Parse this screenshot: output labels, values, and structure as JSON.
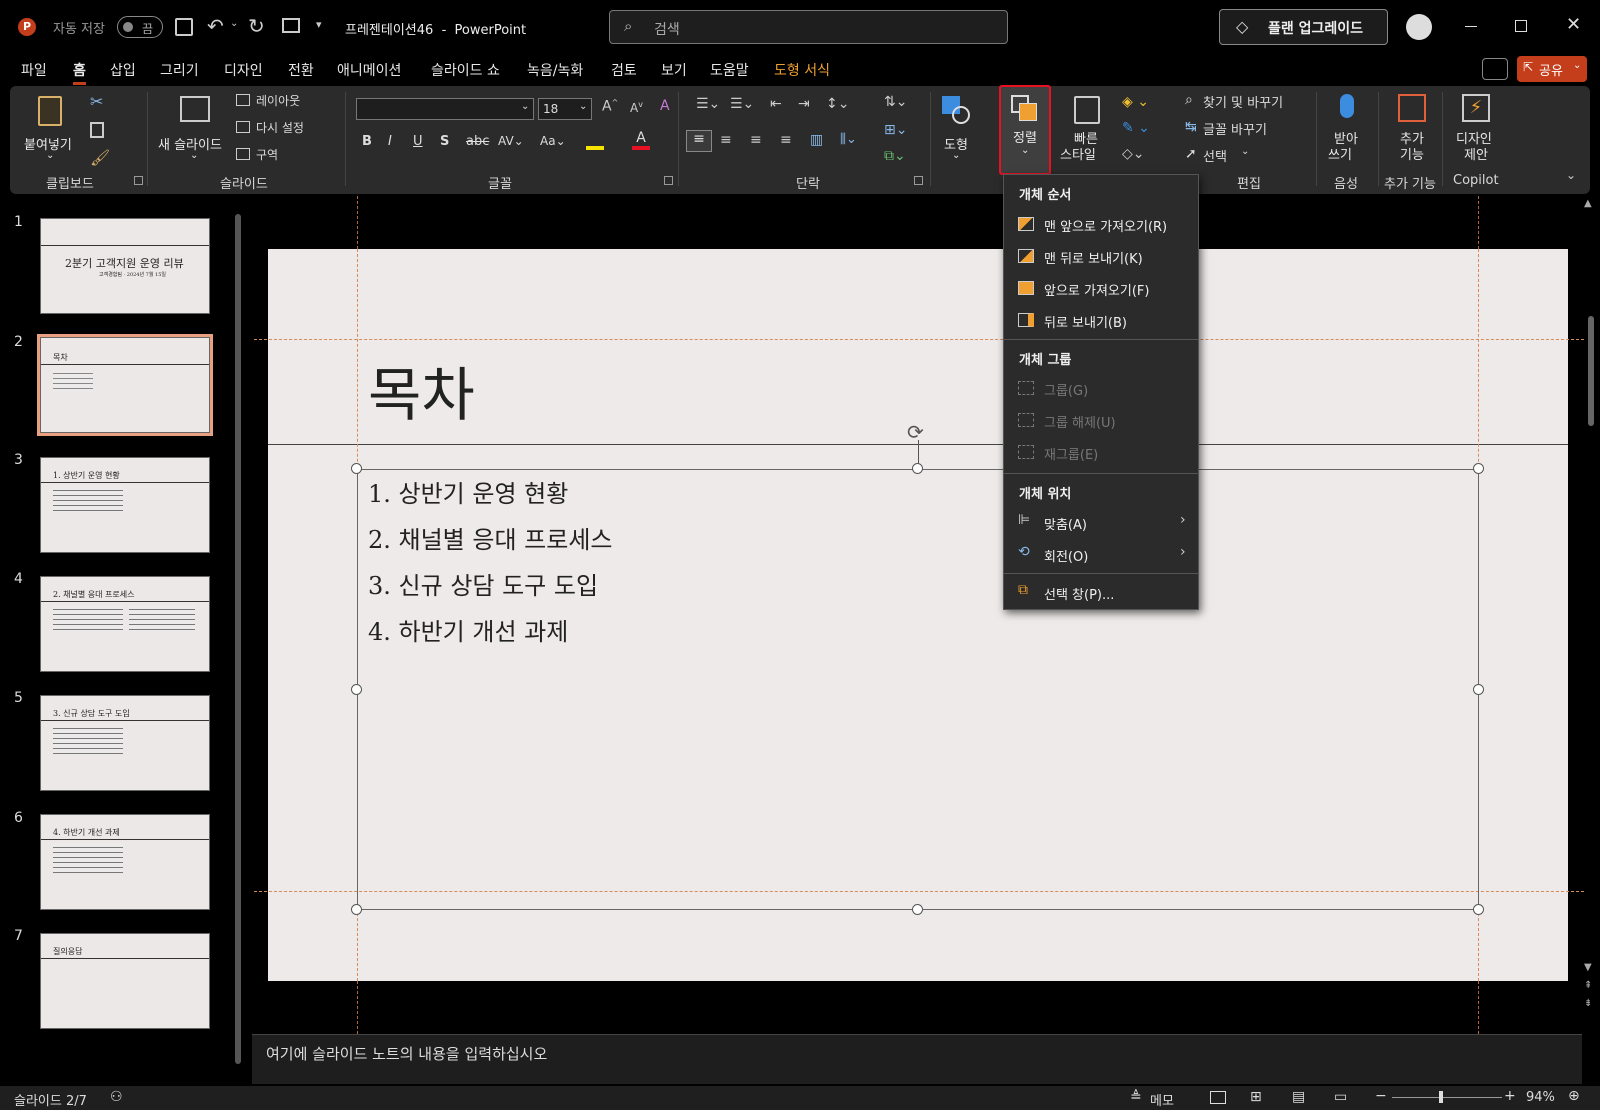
{
  "title_bar": {
    "autosave_label": "자동 저장",
    "autosave_state": "끔",
    "doc_title": "프레젠테이션46  -  PowerPoint",
    "search_placeholder": "검색",
    "upgrade_label": "플랜 업그레이드"
  },
  "tabs": [
    "파일",
    "홈",
    "삽입",
    "그리기",
    "디자인",
    "전환",
    "애니메이션",
    "슬라이드 쇼",
    "녹음/녹화",
    "검토",
    "보기",
    "도움말",
    "도형 서식"
  ],
  "share_label": "공유",
  "ribbon": {
    "clipboard": {
      "paste": "붙여넣기",
      "group": "클립보드"
    },
    "slides": {
      "new_slide": "새 슬라이드",
      "layout": "레이아웃",
      "reset": "다시 설정",
      "section": "구역",
      "group": "슬라이드"
    },
    "font": {
      "font_name": "",
      "font_size": "18",
      "group": "글꼴"
    },
    "paragraph": {
      "group": "단락"
    },
    "drawing": {
      "shapes": "도형",
      "arrange": "정렬",
      "quick_styles_1": "빠른",
      "quick_styles_2": "스타일"
    },
    "editing": {
      "find": "찾기 및 바꾸기",
      "replace": "글꼴 바꾸기",
      "select": "선택",
      "group": "편집"
    },
    "voice": {
      "dictate_1": "받아",
      "dictate_2": "쓰기",
      "group": "음성"
    },
    "addins": {
      "label_1": "추가",
      "label_2": "기능",
      "group": "추가 기능"
    },
    "designer": {
      "label_1": "디자인",
      "label_2": "제안",
      "group": "Copilot"
    }
  },
  "thumbnails": [
    {
      "num": "1",
      "title": "2분기 고객지원 운영 리뷰",
      "sub": "고객경험팀 · 2024년 7월 15일"
    },
    {
      "num": "2",
      "title": "목차"
    },
    {
      "num": "3",
      "title": "1. 상반기 운영 현황"
    },
    {
      "num": "4",
      "title": "2. 채널별 응대 프로세스"
    },
    {
      "num": "5",
      "title": "3. 신규 상담 도구 도입"
    },
    {
      "num": "6",
      "title": "4. 하반기 개선 과제"
    },
    {
      "num": "7",
      "title": "질의응답"
    }
  ],
  "slide": {
    "title": "목차",
    "bullets": [
      "1. 상반기 운영 현황",
      "2. 채널별 응대 프로세스",
      "3. 신규 상담 도구 도입",
      "4. 하반기 개선 과제"
    ]
  },
  "notes_placeholder": "여기에 슬라이드 노트의 내용을 입력하십시오",
  "menu": {
    "order_header": "개체 순서",
    "bring_front": "맨 앞으로 가져오기(R)",
    "send_back": "맨 뒤로 보내기(K)",
    "bring_forward": "앞으로 가져오기(F)",
    "send_backward": "뒤로 보내기(B)",
    "group_header": "개체 그룹",
    "group": "그룹(G)",
    "ungroup": "그룹 해제(U)",
    "regroup": "재그룹(E)",
    "position_header": "개체 위치",
    "align": "맞춤(A)",
    "rotate": "회전(O)",
    "selection_pane": "선택 창(P)..."
  },
  "status": {
    "slide_counter": "슬라이드 2/7",
    "notes": "메모",
    "zoom": "94%"
  },
  "colors": {
    "accent": "#c43e1c",
    "highlight_box": "#e81123",
    "orange_tab": "#f0a030"
  }
}
